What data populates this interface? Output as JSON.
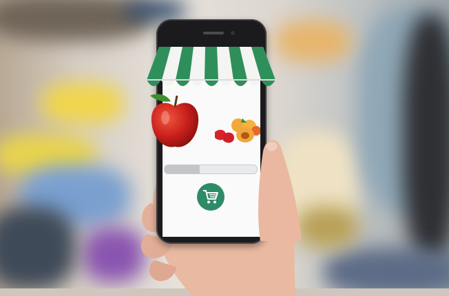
{
  "scene": {
    "description_tags": [
      "grocery-store-background",
      "smartphone",
      "hand"
    ],
    "colors": {
      "awning_green": "#2e8f5a",
      "awning_white": "#f4f4f2",
      "cart_button": "#2e8b68",
      "screen_bg": "#fafafa",
      "phone_body": "#1b1b1d"
    }
  },
  "app": {
    "icons": {
      "cart": "shopping-cart-icon",
      "apple": "apple-icon",
      "fruits": "fruit-pile-icon",
      "awning": "shop-awning-icon"
    },
    "progress": 0.38
  }
}
